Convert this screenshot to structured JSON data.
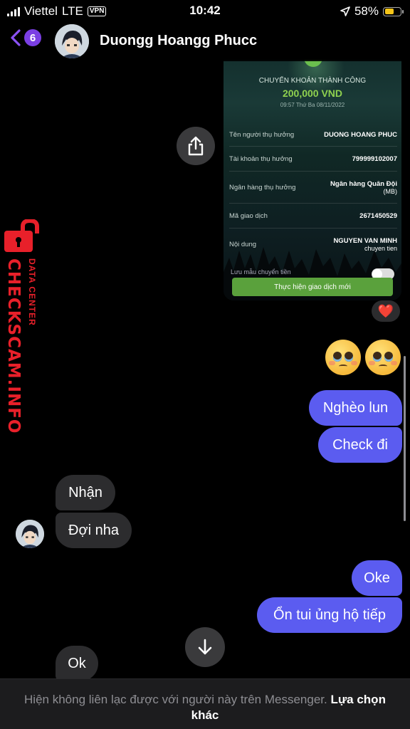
{
  "status_bar": {
    "carrier": "Viettel",
    "network": "LTE",
    "vpn": "VPN",
    "time": "10:42",
    "battery": "58%",
    "battery_level": 0.58
  },
  "header": {
    "unread_count": "6",
    "contact_name": "Duongg Hoangg Phucc"
  },
  "receipt": {
    "title": "CHUYỂN KHOẢN THÀNH CÔNG",
    "amount": "200,000 VND",
    "datetime": "09:57 Thứ Ba 08/11/2022",
    "rows": [
      {
        "label": "Tên người thụ hưởng",
        "value": "DUONG HOANG PHUC",
        "sub": ""
      },
      {
        "label": "Tài khoản thụ hưởng",
        "value": "799999102007",
        "sub": ""
      },
      {
        "label": "Ngân hàng thụ hưởng",
        "value": "Ngân hàng Quân Đội",
        "sub": "(MB)"
      },
      {
        "label": "Mã giao dịch",
        "value": "2671450529",
        "sub": ""
      },
      {
        "label": "Nội dung",
        "value": "NGUYEN VAN MINH",
        "sub": "chuyen tien"
      }
    ],
    "save_template_label": "Lưu mẫu chuyển tiền",
    "new_transaction_button": "Thực hiện giao dịch mới"
  },
  "reaction": "❤️",
  "messages": [
    {
      "direction": "out",
      "text": "Nghèo lun"
    },
    {
      "direction": "out",
      "text": "Check đi"
    },
    {
      "direction": "in",
      "text": "Nhận"
    },
    {
      "direction": "in",
      "text": "Đợi nha"
    },
    {
      "direction": "out",
      "text": "Oke"
    },
    {
      "direction": "out",
      "text": "Ổn tui ủng hộ tiếp"
    },
    {
      "direction": "in",
      "text": "Ok"
    }
  ],
  "footer": {
    "notice": "Hiện không liên lạc được với người này trên Messenger.",
    "action": "Lựa chọn khác"
  },
  "watermark": {
    "brand": "CHECKSCAM.INFO",
    "tagline": "DATA CENTER"
  },
  "colors": {
    "outgoing_bubble": "#5b5cf0",
    "incoming_bubble": "#2c2c2e",
    "accent": "#7b3fe4",
    "watermark": "#e8202a"
  }
}
